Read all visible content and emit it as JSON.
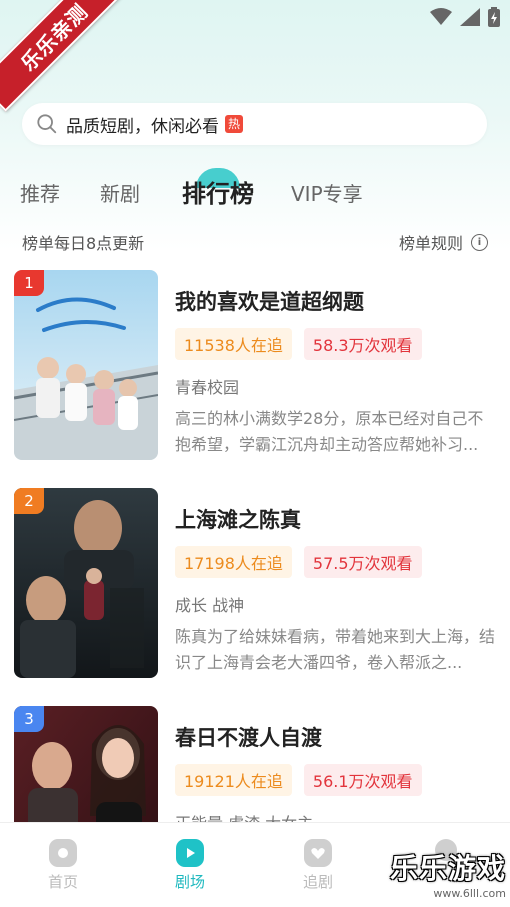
{
  "watermark": {
    "corner": "乐乐亲测",
    "brand": "乐乐游戏",
    "url": "www.6lll.com"
  },
  "search": {
    "placeholder_text": "品质短剧，休闲必看",
    "hot_badge": "热"
  },
  "tabs": [
    {
      "label": "推荐",
      "active": false
    },
    {
      "label": "新剧",
      "active": false
    },
    {
      "label": "排行榜",
      "active": true
    },
    {
      "label": "VIP专享",
      "active": false
    }
  ],
  "subbar": {
    "update_text": "榜单每日8点更新",
    "rules_text": "榜单规则",
    "info_icon": "i"
  },
  "dramas": [
    {
      "rank": "1",
      "rank_color": "#e8382f",
      "title": "我的喜欢是道超纲题",
      "followers": "11538人在追",
      "views": "58.3万次观看",
      "genre": "青春校园",
      "description": "高三的林小满数学28分，原本已经对自己不抱希望，学霸江沉舟却主动答应帮她补习..."
    },
    {
      "rank": "2",
      "rank_color": "#f07c22",
      "title": "上海滩之陈真",
      "followers": "17198人在追",
      "views": "57.5万次观看",
      "genre": "成长 战神",
      "description": "陈真为了给妹妹看病，带着她来到大上海，结识了上海青会老大潘四爷，卷入帮派之..."
    },
    {
      "rank": "3",
      "rank_color": "#4a86f0",
      "title": "春日不渡人自渡",
      "followers": "19121人在追",
      "views": "56.1万次观看",
      "genre": "正能量 虐渣 大女主",
      "description": ""
    }
  ],
  "bottom_nav": [
    {
      "label": "首页",
      "icon": "home-icon",
      "active": false
    },
    {
      "label": "剧场",
      "icon": "theater-play-icon",
      "active": true
    },
    {
      "label": "追剧",
      "icon": "heart-icon",
      "active": false
    },
    {
      "label": "",
      "icon": "profile-icon",
      "active": false
    }
  ]
}
